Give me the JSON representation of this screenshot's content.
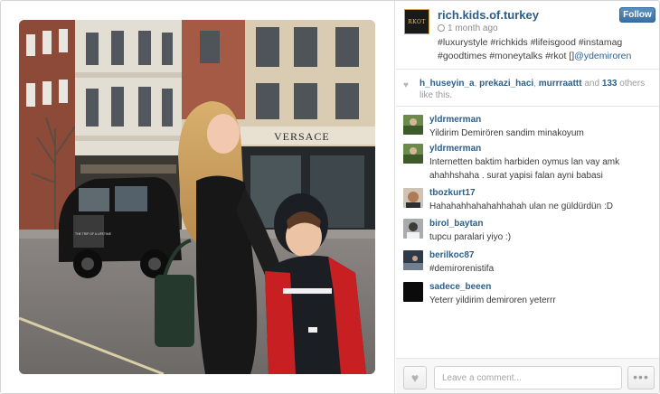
{
  "post": {
    "username": "rich.kids.of.turkey",
    "avatar_text": "RKOT",
    "time": "1 month ago",
    "caption_tags": "#luxurystyle #richkids #lifeisgood #instamag #goodtimes #moneytalks #rkot []",
    "caption_mention": "@ydemiroren",
    "follow_label": "Follow",
    "photo_sign": "VERSACE",
    "taxi_ad": "THE TRIP OF A LIFETIME"
  },
  "likes": {
    "users": [
      "h_huseyin_a",
      "prekazi_haci",
      "murrraattt"
    ],
    "separator_1": ", ",
    "separator_2": ", ",
    "and_text": " and ",
    "count": "133",
    "suffix": " others like this."
  },
  "comments": [
    {
      "user": "yldrmerman",
      "text": "Yildirim Demirören sandim minakoyum"
    },
    {
      "user": "yldrmerman",
      "text": "Internetten baktim harbiden oymus lan vay amk ahahhshaha . surat yapisi falan ayni babasi"
    },
    {
      "user": "tbozkurt17",
      "text": "Hahahahhahahahhahah ulan ne güldürdün :D"
    },
    {
      "user": "birol_baytan",
      "text": "tupcu paralari yiyo :)"
    },
    {
      "user": "berilkoc87",
      "text": "#demirorenistifa"
    },
    {
      "user": "sadece_beeen",
      "text": "Yeterr yildirim demiroren yeterrr"
    }
  ],
  "footer": {
    "comment_placeholder": "Leave a comment...",
    "more_label": "•••"
  },
  "icons": {
    "like": "heart-icon",
    "time": "clock-icon",
    "more": "more-dots-icon"
  },
  "colors": {
    "link": "#2b5f8a",
    "follow_button": "#3b70a3"
  }
}
